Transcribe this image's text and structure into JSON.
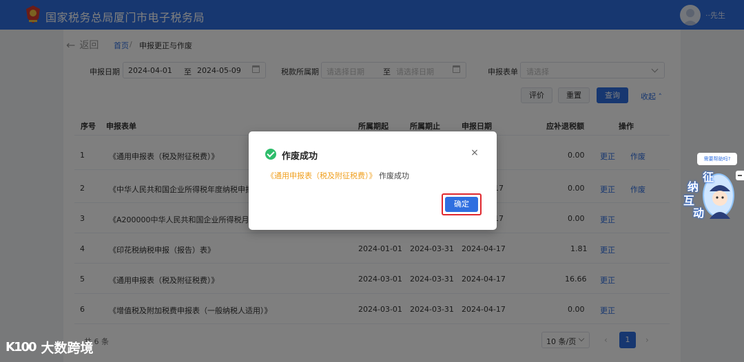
{
  "header": {
    "site_title": "国家税务总局厦门市电子税务局",
    "user_name": "··先生"
  },
  "nav": {
    "back_label": "返回",
    "breadcrumb_home": "首页",
    "breadcrumb_sep": "/",
    "breadcrumb_current": "申报更正与作废"
  },
  "filters": {
    "declare_date_label": "申报日期",
    "declare_date_start": "2024-04-01",
    "range_to": "至",
    "declare_date_end": "2024-05-09",
    "tax_period_label": "税款所属期",
    "tax_period_start_placeholder": "请选择日期",
    "tax_period_end_placeholder": "请选择日期",
    "form_label": "申报表单",
    "form_placeholder": "请选择"
  },
  "actions": {
    "evaluate": "评价",
    "reset": "重置",
    "query": "查询",
    "collapse": "收起"
  },
  "table": {
    "headers": [
      "序号",
      "申报表单",
      "所属期起",
      "所属期止",
      "申报日期",
      "应补退税额",
      "操作"
    ],
    "rows": [
      {
        "no": "1",
        "form": "《通用申报表（税及附征税费）》",
        "start": "",
        "end": "",
        "date": "",
        "amount": "0.00",
        "correct": "更正",
        "void": "作废"
      },
      {
        "no": "2",
        "form": "《中华人民共和国企业所得税年度纳税申报表",
        "start": "",
        "end": "",
        "date": "17",
        "amount": "0.00",
        "correct": "更正",
        "void": "作废"
      },
      {
        "no": "3",
        "form": "《A200000中华人民共和国企业所得税月（",
        "start": "",
        "end": "",
        "date": "17",
        "amount": "0.00",
        "correct": "更正",
        "void": ""
      },
      {
        "no": "4",
        "form": "《印花税纳税申报（报告）表》",
        "start": "2024-01-01",
        "end": "2024-03-31",
        "date": "2024-04-17",
        "amount": "1.81",
        "correct": "更正",
        "void": ""
      },
      {
        "no": "5",
        "form": "《通用申报表（税及附征税费）》",
        "start": "2024-03-01",
        "end": "2024-03-31",
        "date": "2024-04-17",
        "amount": "16.66",
        "correct": "更正",
        "void": ""
      },
      {
        "no": "6",
        "form": "《增值税及附加税费申报表（一般纳税人适用）》",
        "start": "2024-03-01",
        "end": "2024-03-31",
        "date": "2024-04-17",
        "amount": "0.00",
        "correct": "更正",
        "void": ""
      }
    ]
  },
  "pagination": {
    "total": "共 6 条",
    "page_size": "10 条/页",
    "prev": "‹",
    "current_page": "1",
    "next": "›"
  },
  "dialog": {
    "title": "作废成功",
    "message_highlight": "《通用申报表（税及附征税费）》",
    "message_rest": "作废成功",
    "confirm": "确定",
    "close": "×"
  },
  "assistant": {
    "bubble": "需要帮助吗?",
    "chars": [
      "征",
      "纳",
      "互",
      "动"
    ]
  },
  "watermark": {
    "mark": "K100",
    "text": "大数跨境"
  }
}
